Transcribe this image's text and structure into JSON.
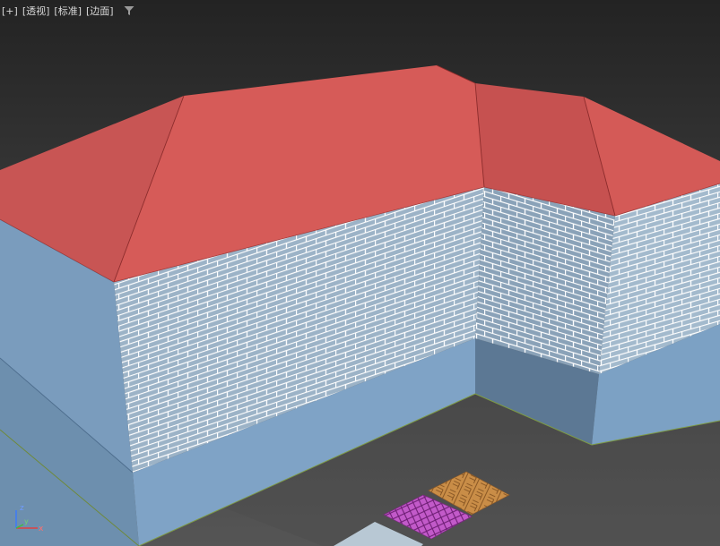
{
  "viewport": {
    "labels": [
      "[+]",
      "[透视]",
      "[标准]",
      "[边面]"
    ],
    "filter_icon": "filter-icon"
  },
  "axis_gizmo": {
    "x_label": "x",
    "y_label": "y",
    "z_label": "z"
  },
  "colors": {
    "background_top": "#232323",
    "background_bottom": "#525252",
    "roof": "#d45a57",
    "roof_dark": "#c65150",
    "wall_blue": "#7ea3c8",
    "wall_blue_dark": "#5a7590",
    "brick_face": "#9fb8cc",
    "brick_mortar": "#ffffff",
    "wood_floor": "#c98d47",
    "purple_floor": "#c25ac9"
  }
}
